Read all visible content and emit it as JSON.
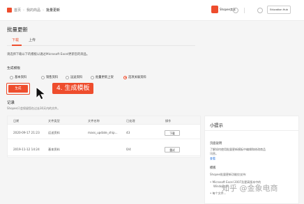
{
  "topbar": {
    "breadcrumbs": [
      "首页",
      "我的商品",
      "批量更新"
    ],
    "brand": "Shopee卖家",
    "account_label": "Education Hub"
  },
  "page": {
    "title": "批量更新",
    "tabs": [
      {
        "label": "下载",
        "active": true
      },
      {
        "label": "上传",
        "active": false
      }
    ],
    "intro": "请选择下载以下的模板以通过Microsoft Excel更新您的商品。",
    "template_label": "生成模板",
    "options": [
      {
        "label": "基本资料",
        "selected": false
      },
      {
        "label": "销售资料",
        "selected": false
      },
      {
        "label": "运送资料",
        "selected": false
      },
      {
        "label": "批量更新上架",
        "selected": false
      },
      {
        "label": "选项关联资料",
        "selected": true
      }
    ],
    "generate_button": "生成",
    "annotation": "4. 生成模板"
  },
  "records": {
    "title": "记录",
    "subtitle": "Shopee只会保留您在过去30天内的文件。",
    "columns": [
      "日期",
      "文件类型",
      "文件名称",
      "已处理",
      "操作"
    ],
    "rows": [
      {
        "date": "2020-09-17 21:23",
        "type": "运送资料",
        "name": "mass_update_ship...",
        "processed": "43",
        "action": "下载"
      },
      {
        "date": "2019-11-12 14:24",
        "type": "基本资料",
        "name": "",
        "processed": "0/4",
        "action": "重试"
      }
    ]
  },
  "tips": {
    "title": "小提示",
    "section1_heading": "页面说明",
    "section1_lines": [
      "了解如何使用批量更新模板中编辑和修改商品",
      "讯息。"
    ],
    "section1_link": "查看",
    "section2_heading": "模板",
    "section2_text": "Shopee批量更新功能仅支持:",
    "section2_items": [
      "Microsoft Excel 2007及更高版本中的",
      "Windows平..."
    ],
    "section2_item2": "每个文件..."
  },
  "watermark": "知乎 @金象电商",
  "colors": {
    "accent": "#ee4d2d",
    "link": "#2673dd"
  }
}
